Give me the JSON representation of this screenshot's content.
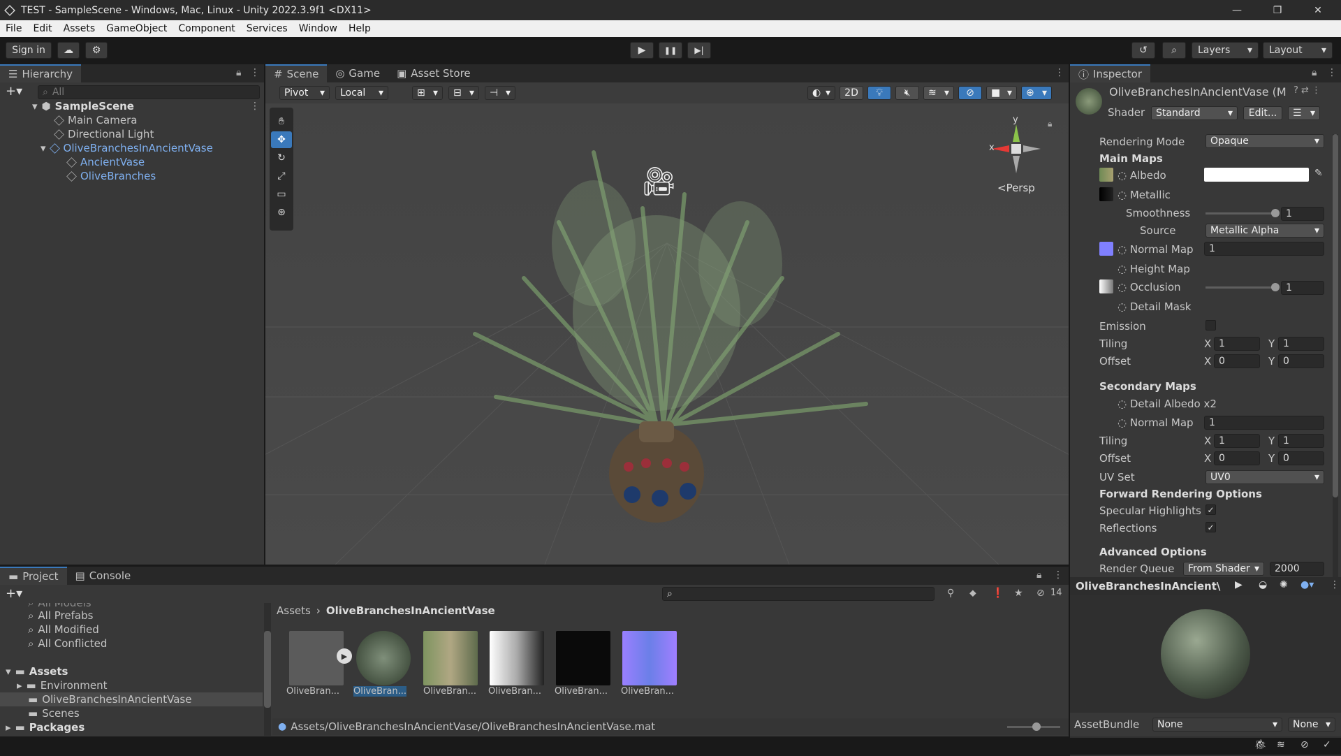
{
  "window": {
    "title": "TEST - SampleScene - Windows, Mac, Linux - Unity 2022.3.9f1 <DX11>",
    "minimize": "—",
    "maximize": "❐",
    "close": "✕"
  },
  "menu": [
    "File",
    "Edit",
    "Assets",
    "GameObject",
    "Component",
    "Services",
    "Window",
    "Help"
  ],
  "toolbar": {
    "sign_in": "Sign in",
    "play": "▶",
    "pause": "❚❚",
    "step": "▶|",
    "layers": "Layers",
    "layout": "Layout"
  },
  "hierarchy": {
    "tab": "Hierarchy",
    "search_placeholder": "All",
    "scene": "SampleScene",
    "items": [
      "Main Camera",
      "Directional Light",
      "OliveBranchesInAncientVase",
      "AncientVase",
      "OliveBranches"
    ]
  },
  "scene": {
    "tabs": [
      "Scene",
      "Game",
      "Asset Store"
    ],
    "pivot": "Pivot",
    "local": "Local",
    "mode_2d": "2D",
    "persp": "<Persp",
    "gizmo_y": "y",
    "gizmo_x": "x"
  },
  "inspector": {
    "tab": "Inspector",
    "object_name": "OliveBranchesInAncientVase (M",
    "shader_label": "Shader",
    "shader_value": "Standard",
    "edit_button": "Edit...",
    "rendering_mode_label": "Rendering Mode",
    "rendering_mode_value": "Opaque",
    "main_maps": "Main Maps",
    "albedo": "Albedo",
    "metallic": "Metallic",
    "smoothness": "Smoothness",
    "smoothness_value": "1",
    "smoothness_level": 1.0,
    "source": "Source",
    "source_value": "Metallic Alpha",
    "normal_map": "Normal Map",
    "normal_map_value": "1",
    "height_map": "Height Map",
    "occlusion": "Occlusion",
    "occlusion_value": "1",
    "occlusion_level": 1.0,
    "detail_mask": "Detail Mask",
    "emission": "Emission",
    "tiling": "Tiling",
    "offset": "Offset",
    "x": "X",
    "y": "Y",
    "tiling_x": "1",
    "tiling_y": "1",
    "offset_x": "0",
    "offset_y": "0",
    "secondary_maps": "Secondary Maps",
    "detail_albedo": "Detail Albedo x2",
    "sec_normal_map": "Normal Map",
    "sec_normal_value": "1",
    "sec_tiling_x": "1",
    "sec_tiling_y": "1",
    "sec_offset_x": "0",
    "sec_offset_y": "0",
    "uv_set": "UV Set",
    "uv_set_value": "UV0",
    "forward_options": "Forward Rendering Options",
    "specular_highlights": "Specular Highlights",
    "reflections": "Reflections",
    "advanced_options": "Advanced Options",
    "render_queue": "Render Queue",
    "render_queue_source": "From Shader",
    "render_queue_value": "2000",
    "preview_title": "OliveBranchesInAncient\\",
    "asset_bundle": "AssetBundle",
    "asset_bundle_value": "None",
    "asset_bundle_variant": "None",
    "check": "✓"
  },
  "project": {
    "tabs": [
      "Project",
      "Console"
    ],
    "favorites": [
      "All Models",
      "All Prefabs",
      "All Modified",
      "All Conflicted"
    ],
    "assets_root": "Assets",
    "folders": [
      "Environment",
      "OliveBranchesInAncientVase",
      "Scenes"
    ],
    "packages": "Packages",
    "breadcrumb_root": "Assets",
    "breadcrumb_leaf": "OliveBranchesInAncientVase",
    "hidden_count": "14",
    "thumbs": [
      "OliveBran...",
      "OliveBran...",
      "OliveBran...",
      "OliveBran...",
      "OliveBran...",
      "OliveBran..."
    ],
    "status_path": "Assets/OliveBranchesInAncientVase/OliveBranchesInAncientVase.mat"
  },
  "colors": {
    "accent": "#3a79bb",
    "selection": "#2c5d87",
    "link": "#7fb0f0"
  }
}
